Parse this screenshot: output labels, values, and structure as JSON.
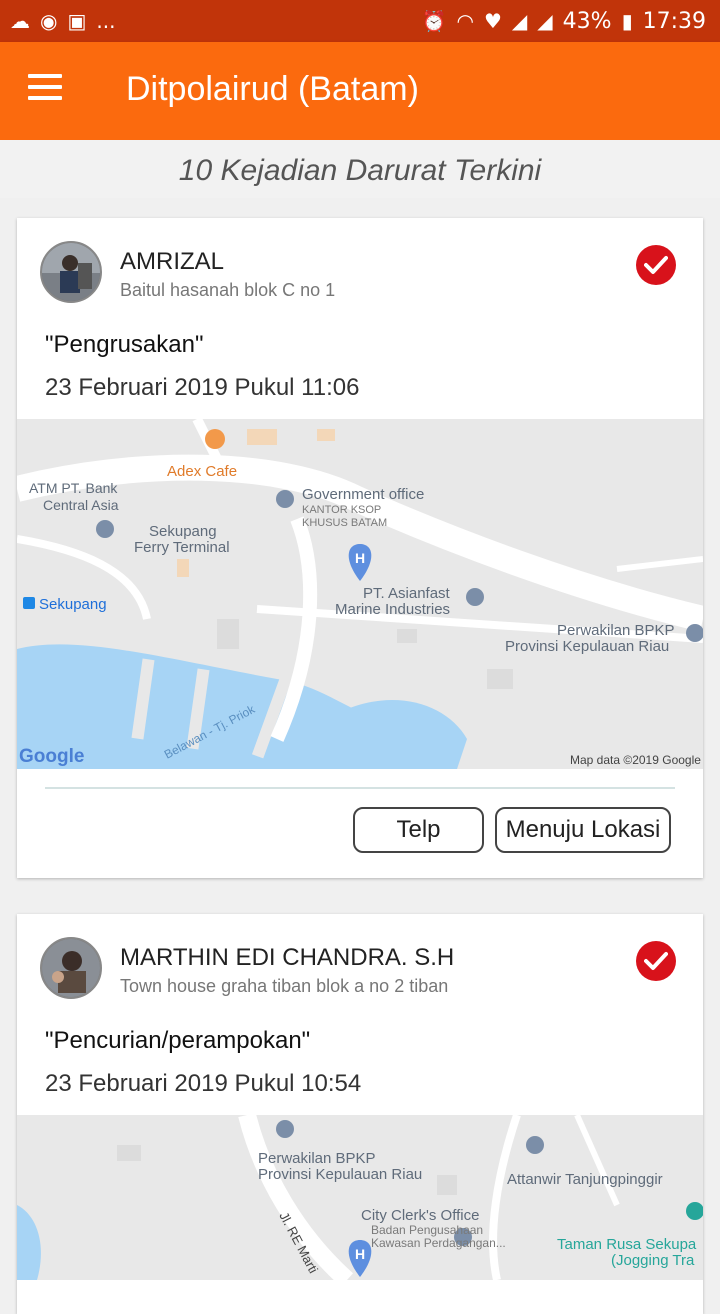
{
  "status_bar": {
    "more": "...",
    "battery": "43%",
    "time": "17:39"
  },
  "app_bar": {
    "title": "Ditpolairud (Batam)",
    "menu_icon": "hamburger-menu-icon"
  },
  "subheader": "10 Kejadian Darurat Terkini",
  "cards": [
    {
      "name": "AMRIZAL",
      "address": "Baitul hasanah blok C no 1",
      "incident": "\"Pengrusakan\"",
      "datetime": "23 Februari 2019 Pukul 11:06",
      "map": {
        "labels": {
          "adex": "Adex Cafe",
          "atm1": "ATM PT. Bank",
          "atm2": "Central Asia",
          "gov": "Government office",
          "ksop1": "KANTOR KSOP",
          "ksop2": "KHUSUS BATAM",
          "ferry1": "Sekupang",
          "ferry2": "Ferry Terminal",
          "sekupang": "Sekupang",
          "asian1": "PT. Asianfast",
          "asian2": "Marine Industries",
          "bpkp1": "Perwakilan BPKP",
          "bpkp2": "Provinsi Kepulauan Riau",
          "route": "Belawan - Tj. Priok",
          "google": "Google",
          "mapdata": "Map data ©2019 Google"
        }
      },
      "buttons": {
        "call": "Telp",
        "navigate": "Menuju Lokasi"
      }
    },
    {
      "name": "MARTHIN EDI CHANDRA. S.H",
      "address": "Town house graha tiban blok a no 2 tiban",
      "incident": "\"Pencurian/perampokan\"",
      "datetime": "23 Februari 2019 Pukul 10:54",
      "map": {
        "labels": {
          "bpkp1": "Perwakilan BPKP",
          "bpkp2": "Provinsi Kepulauan Riau",
          "attanwir": "Attanwir Tanjungpinggir",
          "city": "City Clerk's Office",
          "badan1": "Badan Pengusahaan",
          "badan2": "Kawasan Perdagangan...",
          "road": "Jl. RE Marti",
          "taman1": "Taman Rusa Sekupa",
          "taman2": "(Jogging Tra"
        }
      }
    }
  ],
  "colors": {
    "status_bar": "#c1340a",
    "app_bar": "#fb6a0e",
    "check": "#d8121b",
    "water": "#a7d4f5",
    "land": "#e8e8e8"
  }
}
